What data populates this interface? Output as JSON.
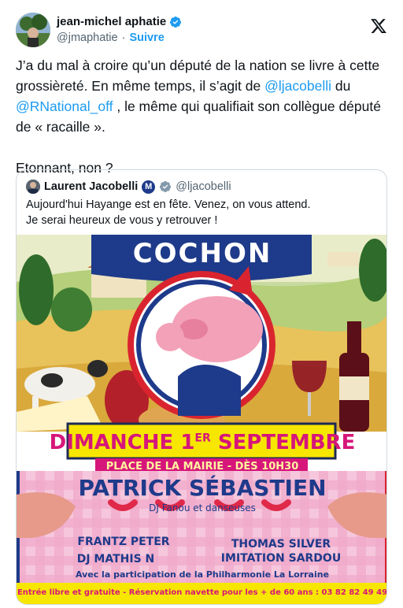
{
  "author": {
    "name": "jean-michel aphatie",
    "handle": "@jmaphatie",
    "separator": "·",
    "follow_label": "Suivre"
  },
  "tweet": {
    "line1_a": "J’a du mal à croire qu’un député de la nation se livre à cette grossièreté. En même temps, il s’agit de ",
    "mention1": "@ljacobelli",
    "line1_b": " du ",
    "mention2": "@RNational_off",
    "line1_c": " , le même qui qualifiait son collègue député de « racaille ».",
    "line2": "Etonnant, non ?"
  },
  "quoted": {
    "name": "Laurent Jacobelli",
    "m_badge": "M",
    "handle": "@ljacobelli",
    "text_line1": "Aujourd'hui Hayange est en fête. Venez, on vous attend.",
    "text_line2": "Je serai heureux de vous y retrouver !"
  },
  "poster": {
    "banner": "COCHON",
    "date_a": "DIMANCHE 1",
    "date_sup": "ER",
    "date_b": " SEPTEMBRE",
    "place": "PLACE DE LA MAIRIE - DÈS 10H30",
    "headliner": "PATRICK SÉBASTIEN",
    "headliner_sub": "DJ Fanou et danseuses",
    "artist1": "FRANTZ PETER",
    "artist2": "THOMAS SILVER",
    "artist3": "DJ MATHIS N",
    "artist4": "IMITATION SARDOU",
    "participation": "Avec la participation de la Philharmonie La Lorraine",
    "footer": "Entrée libre et gratuite - Réservation navette pour les + de 60 ans : 03 82 82 49 49"
  },
  "colors": {
    "link": "#1d9bf0",
    "banner_blue": "#1e3a8a",
    "date_yellow": "#f7e600",
    "date_magenta": "#d6167a",
    "pink_bg": "#f4b8d3"
  }
}
